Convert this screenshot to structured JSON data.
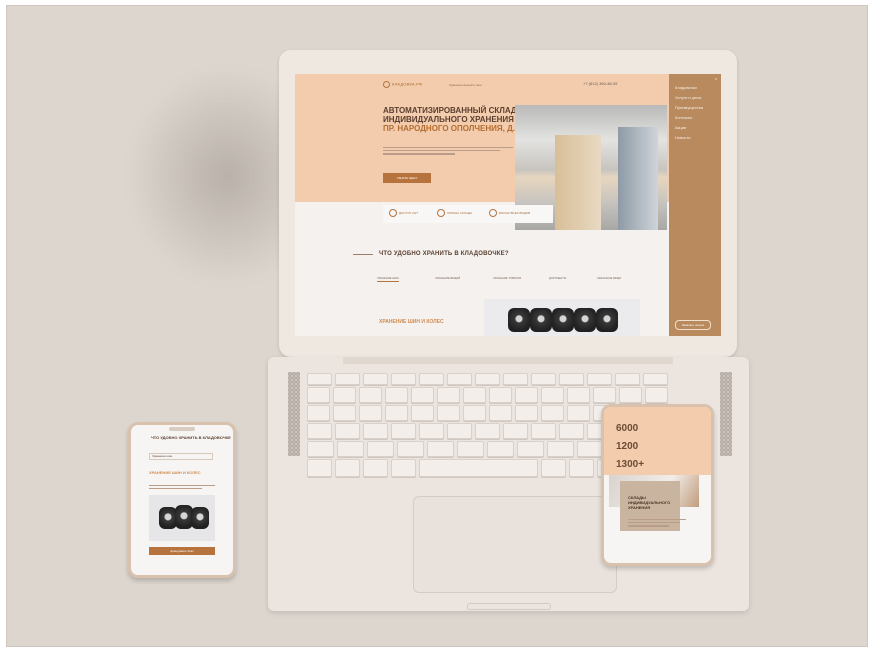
{
  "site": {
    "logo": "КЛАДОВКА.РФ",
    "logo_sub": "Хранение вещей и шин",
    "phone": "+7 (812) 360-48-39",
    "hero_title_1": "АВТОМАТИЗИРОВАННЫЙ СКЛАД",
    "hero_title_2": "ИНДИВИДУАЛЬНОГО ХРАНЕНИЯ НА",
    "hero_title_3": "ПР. НАРОДНОГО ОПОЛЧЕНИЯ, Д. 10",
    "hero_button": "УЗНАТЬ ЦЕНУ",
    "features": [
      "ДОСТУП 24/7",
      "ОХРАНА СКЛАДА",
      "БОКСЫ ВСЕХ ВИДОВ"
    ],
    "question": "ЧТО УДОБНО ХРАНИТЬ В КЛАДОВОЧКЕ?",
    "tabs": [
      "ХРАНЕНИЕ ШИН",
      "ХРАНЕНИЕ ВЕЩЕЙ",
      "ХРАНЕНИЕ ТОВАРОВ",
      "ДОКУМЕНТЫ",
      "СЕЗОННЫЕ ВЕЩИ"
    ],
    "section_label": "ХРАНЕНИЕ ШИН И КОЛЕС",
    "menu": [
      "Кладовочки",
      "Услуги и цены",
      "Преимущества",
      "Контакты",
      "Акции",
      "Новости"
    ],
    "menu_button": "Заказать звонок"
  },
  "phone_left": {
    "title": "ЧТО УДОБНО ХРАНИТЬ В КЛАДОВОЧКЕ",
    "select": "Хранение шин",
    "section": "ХРАНЕНИЕ ШИН И КОЛЕС",
    "button": "Арендовать бокс"
  },
  "phone_right": {
    "stats": [
      "6000",
      "1200",
      "1300+"
    ],
    "title": "СКЛАДЫ ИНДИВИДУАЛЬНОГО ХРАНЕНИЯ"
  }
}
